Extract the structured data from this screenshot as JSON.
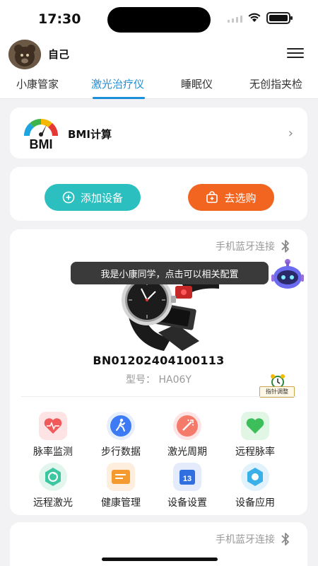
{
  "status_bar": {
    "time": "17:30"
  },
  "header": {
    "username": "自己"
  },
  "tabs": [
    {
      "label": "小康管家"
    },
    {
      "label": "激光治疗仪"
    },
    {
      "label": "睡眠仪"
    },
    {
      "label": "无创指夹检"
    }
  ],
  "bmi": {
    "logo_text": "BMI",
    "title": "BMI计算"
  },
  "actions": {
    "add_device": "添加设备",
    "shop": "去选购"
  },
  "device": {
    "connection": "手机蓝牙连接",
    "tooltip": "我是小康同学，点击可以相关配置",
    "serial": "BN01202404100113",
    "model_label": "型号：",
    "model_value": "HA06Y",
    "pointer_adjust": "指针调整",
    "features": [
      {
        "label": "脉率监测",
        "icon": "pulse-heart-icon"
      },
      {
        "label": "步行数据",
        "icon": "walking-icon"
      },
      {
        "label": "激光周期",
        "icon": "laser-cycle-icon"
      },
      {
        "label": "远程脉率",
        "icon": "remote-heart-icon"
      },
      {
        "label": "远程激光",
        "icon": "remote-laser-icon"
      },
      {
        "label": "健康管理",
        "icon": "health-management-icon"
      },
      {
        "label": "设备设置",
        "icon": "calendar-13-icon",
        "badge": "13"
      },
      {
        "label": "设备应用",
        "icon": "app-icon"
      }
    ]
  },
  "device2": {
    "connection": "手机蓝牙连接"
  },
  "colors": {
    "accent": "#1b8fd8",
    "teal": "#2bbfbf",
    "orange": "#f26521"
  }
}
